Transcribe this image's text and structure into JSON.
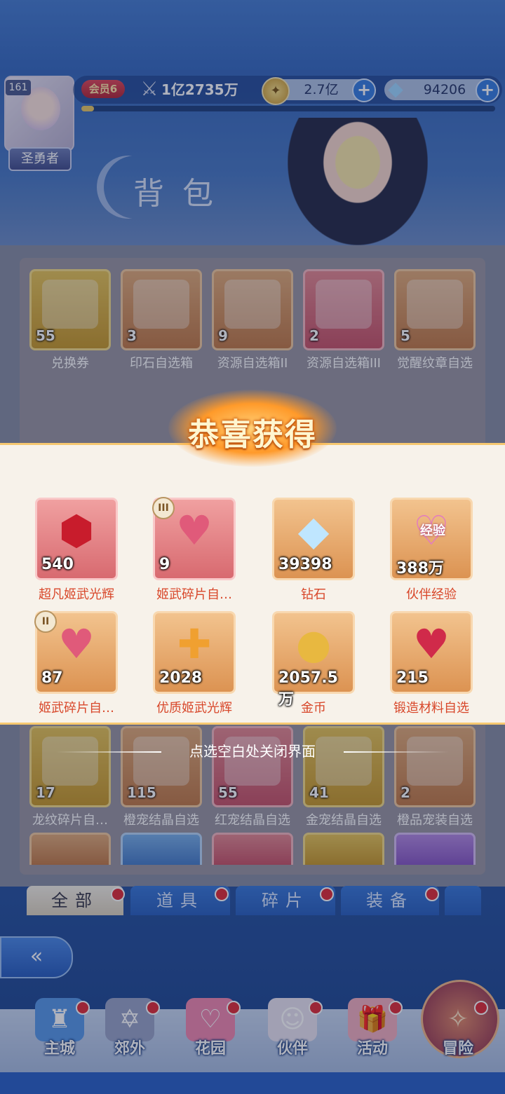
{
  "player": {
    "level": "161",
    "title": "圣勇者",
    "vip": "会员6",
    "power": "1亿2735万",
    "exp_progress": 0.03
  },
  "currency": {
    "gold": "2.7亿",
    "gems": "94206"
  },
  "page_title": "背包",
  "bag_items": [
    {
      "count": "55",
      "name": "兑换券",
      "quality": "gold"
    },
    {
      "count": "3",
      "name": "印石自选箱",
      "quality": "orange"
    },
    {
      "count": "9",
      "name": "资源自选箱II",
      "quality": "orange"
    },
    {
      "count": "2",
      "name": "资源自选箱III",
      "quality": "red"
    },
    {
      "count": "5",
      "name": "觉醒纹章自选",
      "quality": "orange"
    },
    {
      "count": "17",
      "name": "龙纹碎片自…",
      "quality": "gold"
    },
    {
      "count": "115",
      "name": "橙宠结晶自选",
      "quality": "orange"
    },
    {
      "count": "55",
      "name": "红宠结晶自选",
      "quality": "red"
    },
    {
      "count": "41",
      "name": "金宠结晶自选",
      "quality": "gold"
    },
    {
      "count": "2",
      "name": "橙品宠装自选",
      "quality": "orange"
    }
  ],
  "tabs": [
    {
      "label": "全部"
    },
    {
      "label": "道具"
    },
    {
      "label": "碎片"
    },
    {
      "label": "装备"
    }
  ],
  "popup": {
    "title": "恭喜获得",
    "close_hint": "点选空白处关闭界面",
    "rewards": [
      {
        "count": "540",
        "name": "超凡姬武光辉",
        "tier": ""
      },
      {
        "count": "9",
        "name": "姬武碎片自…",
        "tier": "III"
      },
      {
        "count": "39398",
        "name": "钻石",
        "tier": ""
      },
      {
        "count": "388万",
        "name": "伙伴经验",
        "tier": ""
      },
      {
        "count": "87",
        "name": "姬武碎片自…",
        "tier": "II"
      },
      {
        "count": "2028",
        "name": "优质姬武光辉",
        "tier": ""
      },
      {
        "count": "2057.5万",
        "name": "金币",
        "tier": ""
      },
      {
        "count": "215",
        "name": "锻造材料自选",
        "tier": ""
      }
    ],
    "exp_badge": "经验"
  },
  "nav": [
    {
      "label": "主城",
      "icon": "castle-icon"
    },
    {
      "label": "郊外",
      "icon": "suburb-icon"
    },
    {
      "label": "花园",
      "icon": "garden-icon"
    },
    {
      "label": "伙伴",
      "icon": "partner-icon"
    },
    {
      "label": "活动",
      "icon": "gift-icon"
    },
    {
      "label": "冒险",
      "icon": "compass-icon"
    }
  ]
}
